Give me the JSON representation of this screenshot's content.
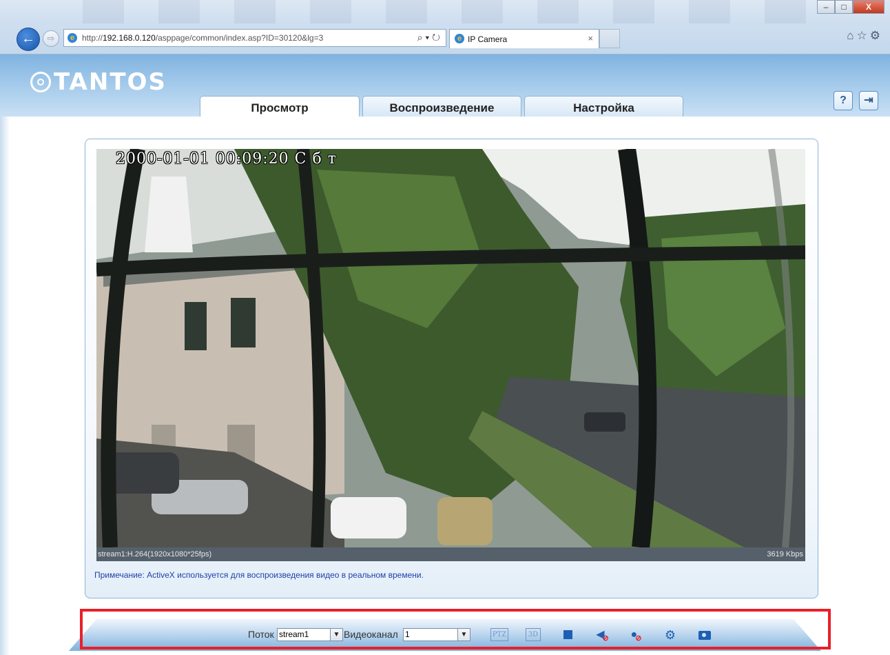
{
  "browser": {
    "url_prefix": "http://",
    "url_host": "192.168.0.120",
    "url_path": "/asppage/common/index.asp?ID=30120&lg=3",
    "search_glyph": "⌕ ▾ ↻",
    "tab_title": "IP Camera",
    "tab_close": "×",
    "win_min": "–",
    "win_max": "□",
    "win_close": "X",
    "right_icons": "⌂☆⚙"
  },
  "header": {
    "logo_text": "TANTOS",
    "tabs": [
      {
        "label": "Просмотр",
        "active": true
      },
      {
        "label": "Воспроизведение",
        "active": false
      },
      {
        "label": "Настройка",
        "active": false
      }
    ],
    "help_glyph": "?",
    "exit_glyph": "⇥"
  },
  "video": {
    "osd_text": "2000-01-01 00:09:20 С б т",
    "stream_info": "stream1:H.264(1920x1080*25fps)",
    "bitrate": "3619 Kbps",
    "note": "Примечание: ActiveX используется для воспроизведения видео в реальном времени."
  },
  "toolbar": {
    "stream_label": "Поток",
    "stream_value": "stream1",
    "channel_label": "Видеоканал",
    "channel_value": "1",
    "ptz_label": "PTZ",
    "three_d_label": "3D",
    "sound_glyph": "◀",
    "mic_glyph": "●",
    "gear_glyph": "⚙",
    "ban_glyph": "⊘"
  },
  "colors": {
    "accent_blue": "#1d5fb5",
    "highlight_red": "#e8202a",
    "note_text": "#1e3fa8"
  }
}
